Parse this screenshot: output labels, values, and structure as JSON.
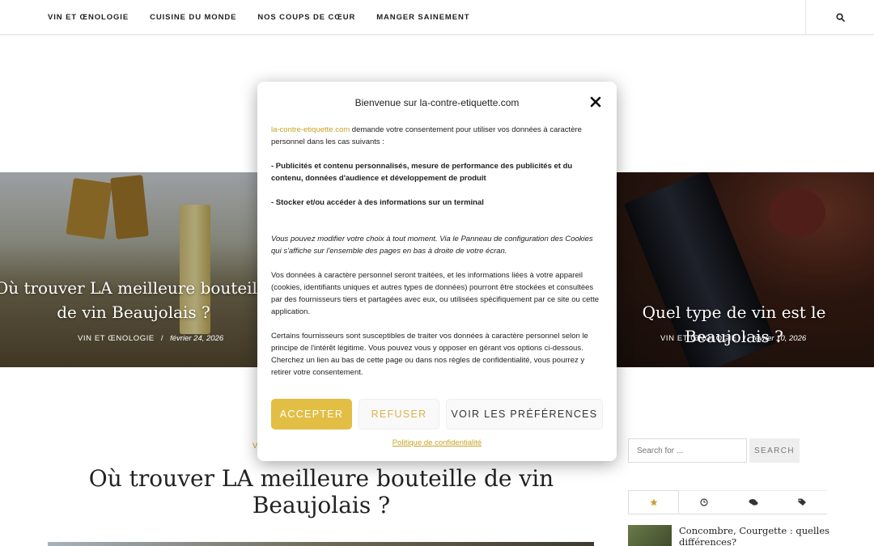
{
  "nav": {
    "items": [
      "VIN ET ŒNOLOGIE",
      "CUISINE DU MONDE",
      "NOS COUPS DE CŒUR",
      "MANGER SAINEMENT"
    ],
    "search_icon": "search-icon"
  },
  "slider": {
    "left": {
      "title": "Où trouver LA meilleure bouteille de vin Beaujolais ?",
      "category": "VIN ET ŒNOLOGIE",
      "date": "février 24, 2026"
    },
    "right": {
      "title": "Quel type de vin est le Beaujolais ?",
      "category": "VIN ET ŒNOLOGIE",
      "date": "février 10, 2026"
    }
  },
  "article": {
    "category": "V",
    "title": "Où trouver LA meilleure bouteille de vin Beaujolais ?"
  },
  "sidebar": {
    "search_placeholder": "Search for ...",
    "search_button": "SEARCH",
    "tabs": [
      "star-icon",
      "clock-icon",
      "comments-icon",
      "tags-icon"
    ],
    "recent_post_title": "Concombre, Courgette : quelles différences?"
  },
  "cookie_modal": {
    "title": "Bienvenue sur la-contre-etiquette.com",
    "intro_link": "la-contre-etiquette.com",
    "intro_text": " demande votre consentement pour utiliser vos données à caractère personnel dans les cas suivants :",
    "purpose_1": "- Publicités et contenu personnalisés, mesure de performance des publicités et du contenu, données d'audience et développement de produit",
    "purpose_2": "- Stocker et/ou accéder à des informations sur un terminal",
    "italic_note": "Vous pouvez modifier votre choix à tout moment. Via le Panneau de configuration des Cookies qui s'affiche sur l'ensemble des pages en bas à droite de votre écran.",
    "paragraph_1": "Vos données à caractère personnel seront traitées, et les informations liées à votre appareil (cookies, identifiants uniques et autres types de données) pourront être stockées et consultées par des fournisseurs tiers et partagées avec eux, ou utilisées spécifiquement par ce site ou cette application.",
    "paragraph_2": "Certains fournisseurs sont susceptibles de traiter vos données à caractère personnel selon le principe de l'intérêt légitime. Vous pouvez vous y opposer en gérant vos options ci-dessous. Cherchez un lien au bas de cette page ou dans nos règles de confidentialité, vous pourrez y retirer votre consentement.",
    "accept_label": "ACCEPTER",
    "refuse_label": "REFUSER",
    "prefs_label": "VOIR LES PRÉFÉRENCES",
    "policy_link": "Politique de confidentialité"
  },
  "colors": {
    "accent": "#c9a227",
    "accept_bg": "#e2be45"
  }
}
